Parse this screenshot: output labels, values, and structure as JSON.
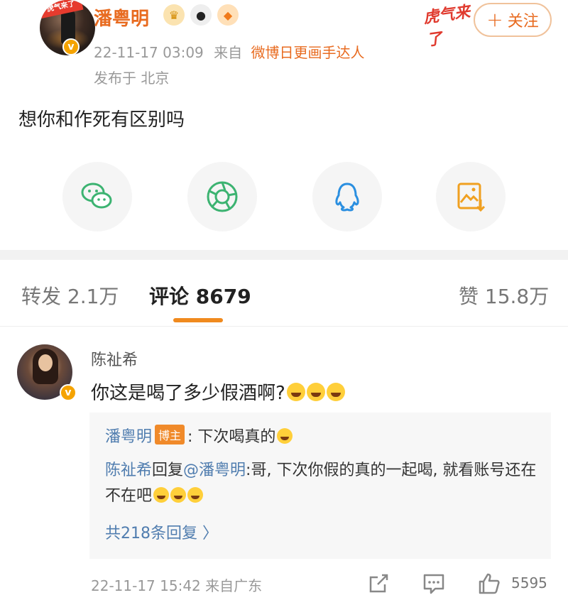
{
  "post": {
    "username": "潘粤明",
    "sticker_text": "虎气来了",
    "follow_label": "关注",
    "timestamp": "22-11-17 03:09",
    "from_label": "来自",
    "source": "微博日更画手达人",
    "location": "发布于 北京",
    "content": "想你和作死有区别吗",
    "badge_icons": [
      "crown-icon",
      "panda-icon",
      "fish-icon"
    ],
    "share_icons": [
      "wechat-icon",
      "moments-icon",
      "qq-icon",
      "save-image-icon"
    ]
  },
  "tabs": {
    "repost": "转发 2.1万",
    "comments": "评论 8679",
    "likes": "赞 15.8万"
  },
  "comment": {
    "username": "陈祉希",
    "text": "你这是喝了多少假酒啊?",
    "reply1_user": "潘粤明",
    "host_tag": "博主",
    "reply1_text": ": 下次喝真的",
    "reply2_user": "陈祉希",
    "reply2_mid": "回复",
    "reply2_target": "@潘粤明",
    "reply2_text": ":哥, 下次你假的真的一起喝, 就看账号还在不在吧",
    "more_replies": "共218条回复 〉",
    "timestamp": "22-11-17 15:42",
    "source": "来自广东",
    "like_count": "5595"
  },
  "colors": {
    "accent": "#e86b20",
    "link": "#507daf",
    "tab_indicator": "#f08a1e",
    "verified": "#f5a300"
  }
}
